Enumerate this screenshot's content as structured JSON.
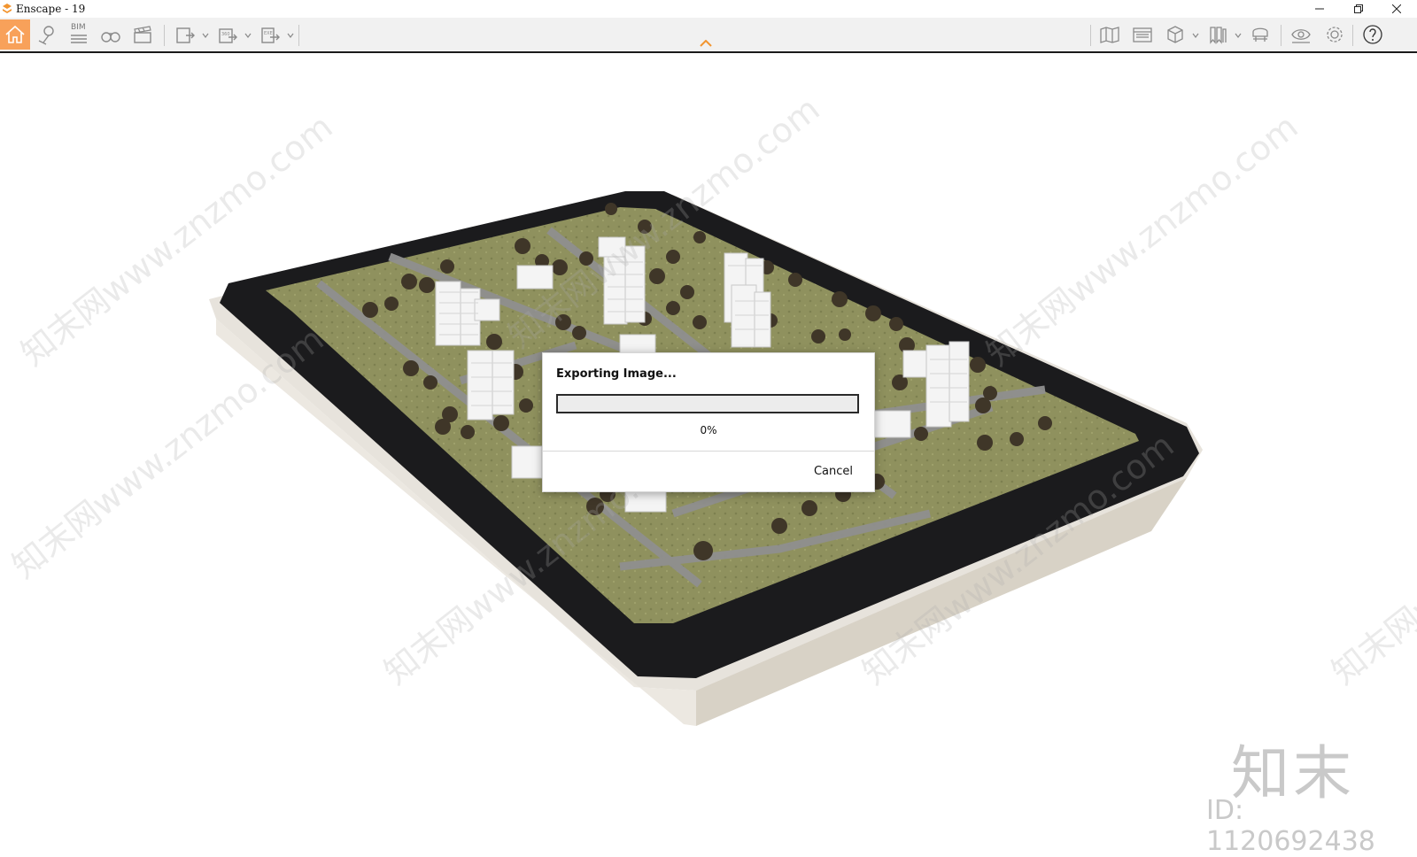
{
  "window": {
    "title": "Enscape - 19",
    "controls": [
      "minimize-icon",
      "restore-icon",
      "close-icon"
    ]
  },
  "toolbar": {
    "bim_label": "BIM",
    "left_tools": [
      "home-icon",
      "map-pin-icon",
      "bim-icon",
      "binoculars-icon",
      "clapperboard-icon",
      "screenshot-export-icon",
      "panorama-360-icon",
      "exe-export-icon"
    ],
    "right_tools": [
      "map-icon",
      "ruler-panel-icon",
      "cube-icon",
      "bookmarks-icon",
      "sun-icon",
      "eye-icon",
      "settings-icon",
      "help-icon"
    ],
    "accent_color": "#f8a15a"
  },
  "dialog": {
    "title": "Exporting Image...",
    "progress": 0,
    "progress_text": "0%",
    "cancel_label": "Cancel"
  },
  "overlay": {
    "watermark_text": "知末网www.znzmo.com",
    "brand": "知末",
    "id_label": "ID: 1120692438"
  }
}
